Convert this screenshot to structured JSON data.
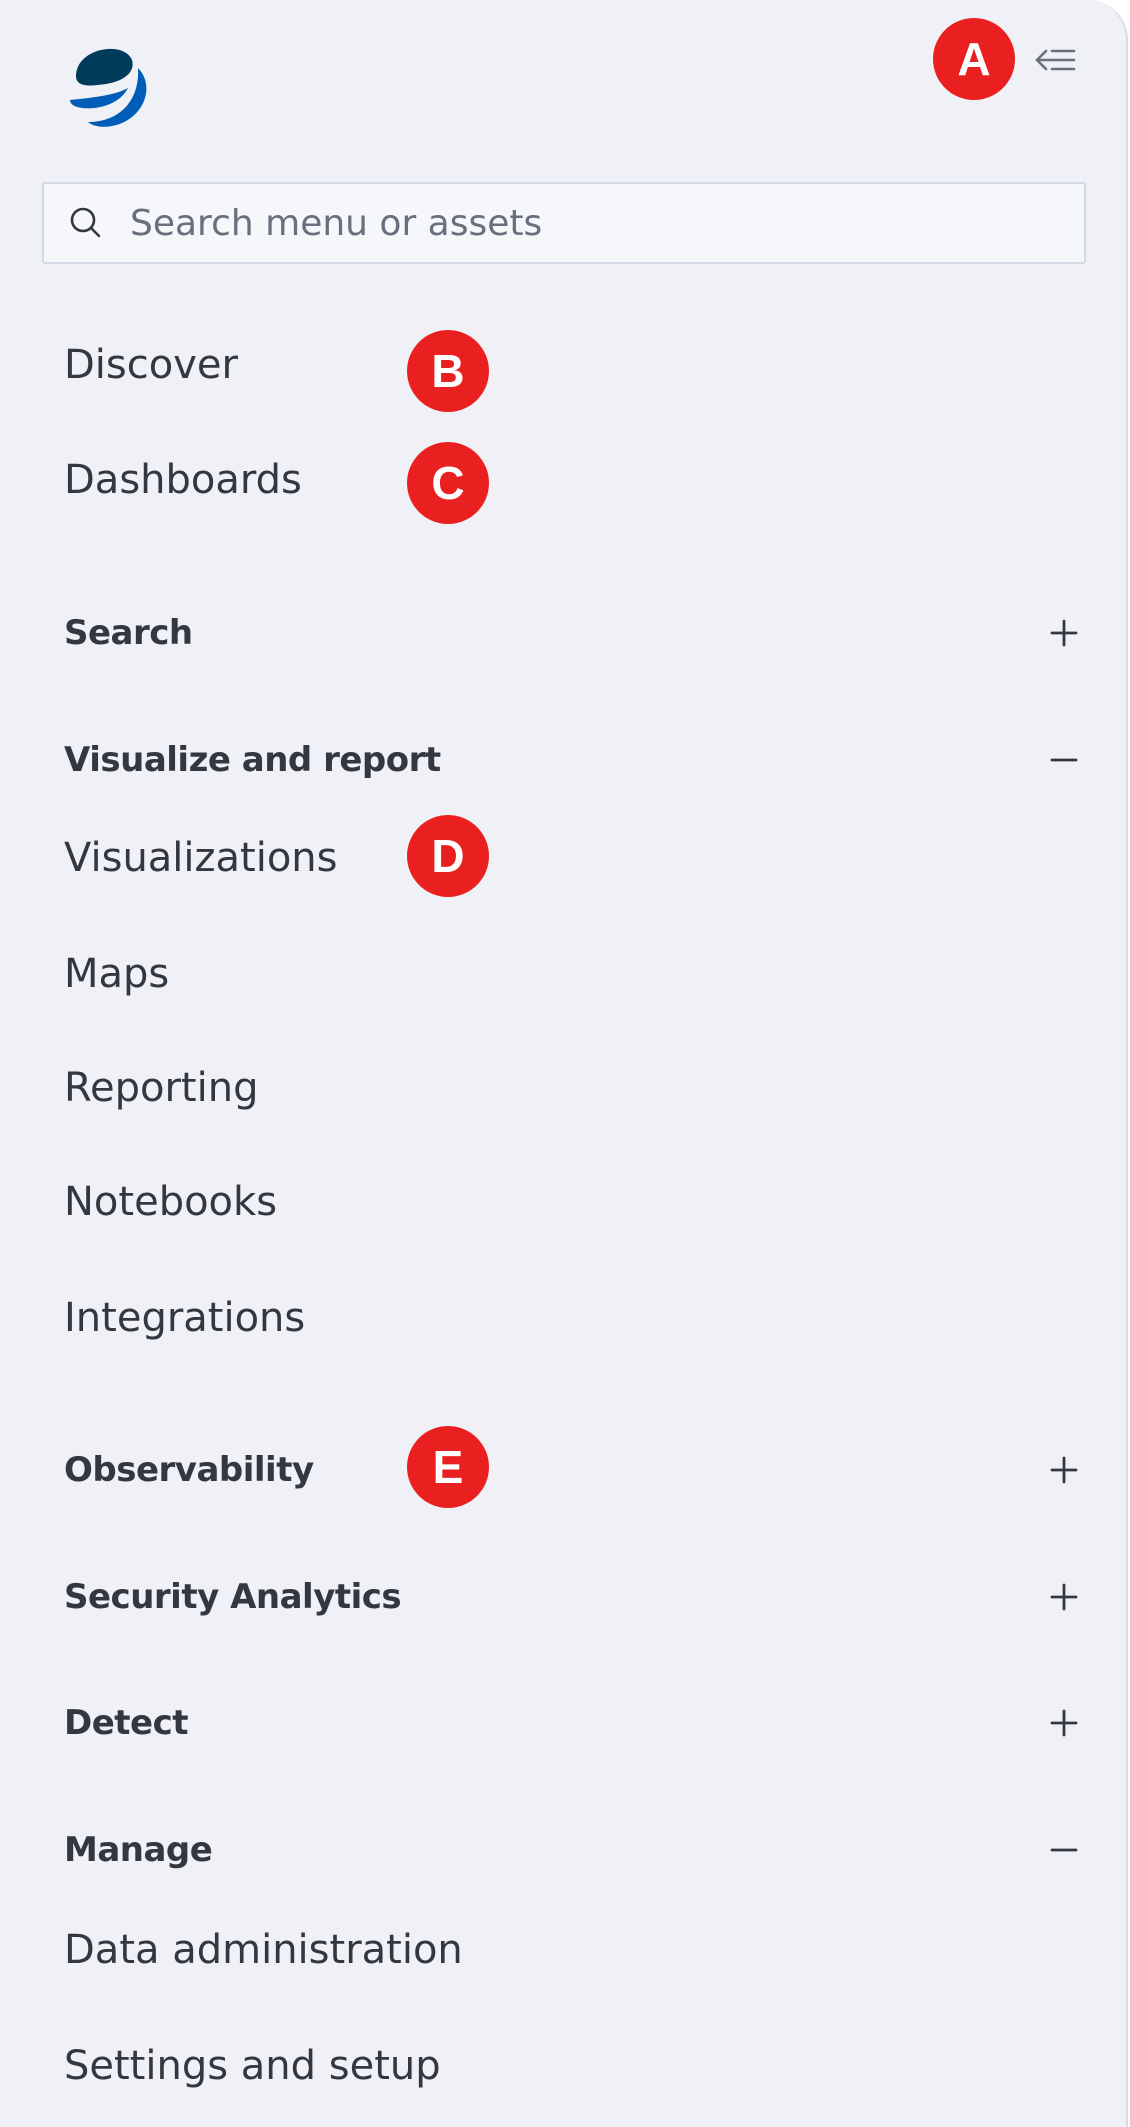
{
  "search": {
    "placeholder": "Search menu or assets"
  },
  "nav": {
    "discover": "Discover",
    "dashboards": "Dashboards"
  },
  "groups": {
    "search": {
      "title": "Search",
      "state": "collapsed"
    },
    "visualize": {
      "title": "Visualize and report",
      "state": "expanded",
      "items": [
        "Visualizations",
        "Maps",
        "Reporting",
        "Notebooks",
        "Integrations"
      ]
    },
    "observability": {
      "title": "Observability",
      "state": "collapsed"
    },
    "security": {
      "title": "Security Analytics",
      "state": "collapsed"
    },
    "detect": {
      "title": "Detect",
      "state": "collapsed"
    },
    "manage": {
      "title": "Manage",
      "state": "expanded",
      "items": [
        "Data administration",
        "Settings and setup"
      ]
    }
  },
  "markers": {
    "a": "A",
    "b": "B",
    "c": "C",
    "d": "D",
    "e": "E"
  },
  "icons": {
    "logo": "opensearch-logo-icon",
    "collapse": "collapse-menu-icon",
    "search": "search-icon",
    "expand": "plus-icon",
    "collapse_group": "minus-icon"
  },
  "colors": {
    "panel_bg": "#f0f1f6",
    "text": "#343741",
    "logo_dark": "#003b5c",
    "logo_blue": "#005eb8",
    "marker": "#ea1f1f"
  }
}
